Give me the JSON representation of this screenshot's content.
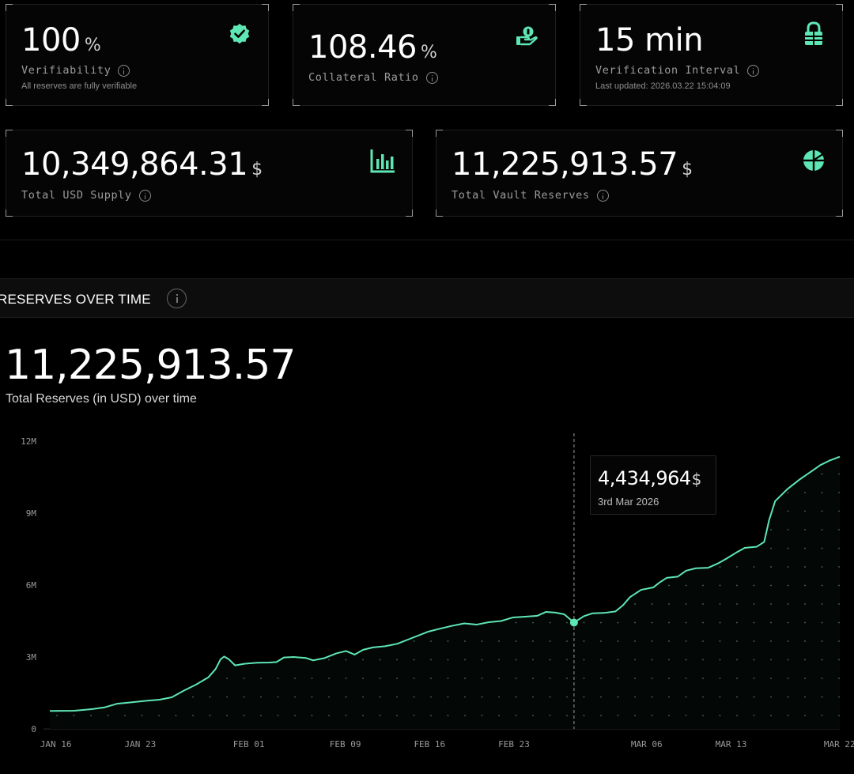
{
  "colors": {
    "accent": "#5ee6b4",
    "background": "#000000",
    "card": "#050505"
  },
  "stats_top": [
    {
      "value": "100",
      "unit": "%",
      "label": "Verifiability",
      "sub": "All reserves are fully verifiable",
      "icon": "verified-badge-icon"
    },
    {
      "value": "108.46",
      "unit": "%",
      "label": "Collateral Ratio",
      "sub": "",
      "icon": "hand-coin-icon"
    },
    {
      "value": "15 min",
      "unit": "",
      "label": "Verification Interval",
      "sub": "Last updated: 2026.03.22 15:04:09",
      "icon": "lock-icon"
    }
  ],
  "stats_bottom": [
    {
      "value": "10,349,864.31",
      "unit": "$",
      "label": "Total USD Supply",
      "icon": "bar-chart-icon"
    },
    {
      "value": "11,225,913.57",
      "unit": "$",
      "label": "Total Vault Reserves",
      "icon": "pie-chart-icon"
    }
  ],
  "section": {
    "title": "RESERVES OVER TIME"
  },
  "reserves": {
    "total": "11,225,913.57",
    "subtitle": "Total Reserves (in USD) over time"
  },
  "tooltip": {
    "value": "4,434,964",
    "unit": "$",
    "date": "3rd Mar 2026"
  },
  "chart_data": {
    "type": "area",
    "title": "",
    "xlabel": "",
    "ylabel": "",
    "ylim": [
      0,
      12000000
    ],
    "y_ticks": [
      "0",
      "3M",
      "6M",
      "9M",
      "12M"
    ],
    "x_ticks": [
      "JAN 16",
      "JAN 23",
      "FEB 01",
      "FEB 09",
      "FEB 16",
      "FEB 23",
      "MAR 06",
      "MAR 13",
      "MAR 22"
    ],
    "grid": false,
    "series": [
      {
        "values": [
          [
            0,
            750000
          ],
          [
            2,
            760000
          ],
          [
            3.5,
            830000
          ],
          [
            4.5,
            900000
          ],
          [
            5.5,
            1050000
          ],
          [
            6.5,
            1100000
          ],
          [
            8,
            1180000
          ],
          [
            9,
            1220000
          ],
          [
            10,
            1320000
          ],
          [
            11,
            1600000
          ],
          [
            12,
            1850000
          ],
          [
            13,
            2150000
          ],
          [
            13.6,
            2500000
          ],
          [
            14,
            2900000
          ],
          [
            14.3,
            3020000
          ],
          [
            14.7,
            2900000
          ],
          [
            15.2,
            2650000
          ],
          [
            16,
            2720000
          ],
          [
            17,
            2760000
          ],
          [
            18,
            2770000
          ],
          [
            18.6,
            2790000
          ],
          [
            19.2,
            2980000
          ],
          [
            20,
            3000000
          ],
          [
            21,
            2960000
          ],
          [
            21.6,
            2860000
          ],
          [
            22.5,
            2950000
          ],
          [
            23.5,
            3150000
          ],
          [
            24.3,
            3250000
          ],
          [
            25,
            3100000
          ],
          [
            25.7,
            3300000
          ],
          [
            26.5,
            3400000
          ],
          [
            27.5,
            3450000
          ],
          [
            28.5,
            3550000
          ],
          [
            29.5,
            3750000
          ],
          [
            31,
            4050000
          ],
          [
            32,
            4180000
          ],
          [
            33,
            4300000
          ],
          [
            34,
            4400000
          ],
          [
            35,
            4350000
          ],
          [
            36,
            4450000
          ],
          [
            37,
            4500000
          ],
          [
            38,
            4650000
          ],
          [
            39,
            4680000
          ],
          [
            40,
            4720000
          ],
          [
            40.7,
            4880000
          ],
          [
            41.5,
            4850000
          ],
          [
            42.2,
            4780000
          ],
          [
            43,
            4434964
          ],
          [
            43.8,
            4700000
          ],
          [
            44.5,
            4820000
          ],
          [
            45.5,
            4840000
          ],
          [
            46.4,
            4900000
          ],
          [
            47,
            5150000
          ],
          [
            47.6,
            5500000
          ],
          [
            48.5,
            5800000
          ],
          [
            49.5,
            5900000
          ],
          [
            50,
            6100000
          ],
          [
            50.6,
            6300000
          ],
          [
            51.5,
            6350000
          ],
          [
            52.2,
            6600000
          ],
          [
            53,
            6700000
          ],
          [
            54,
            6720000
          ],
          [
            54.8,
            6900000
          ],
          [
            55.5,
            7100000
          ],
          [
            56.3,
            7350000
          ],
          [
            57,
            7550000
          ],
          [
            58,
            7600000
          ],
          [
            58.6,
            7800000
          ],
          [
            59,
            8700000
          ],
          [
            59.5,
            9500000
          ],
          [
            60.5,
            10000000
          ],
          [
            61.5,
            10400000
          ],
          [
            62.5,
            10750000
          ],
          [
            63.2,
            11000000
          ],
          [
            64,
            11200000
          ],
          [
            64.8,
            11350000
          ]
        ]
      }
    ],
    "tooltip_point": {
      "x": 43,
      "y": 4434964,
      "label": "3rd Mar 2026"
    }
  }
}
